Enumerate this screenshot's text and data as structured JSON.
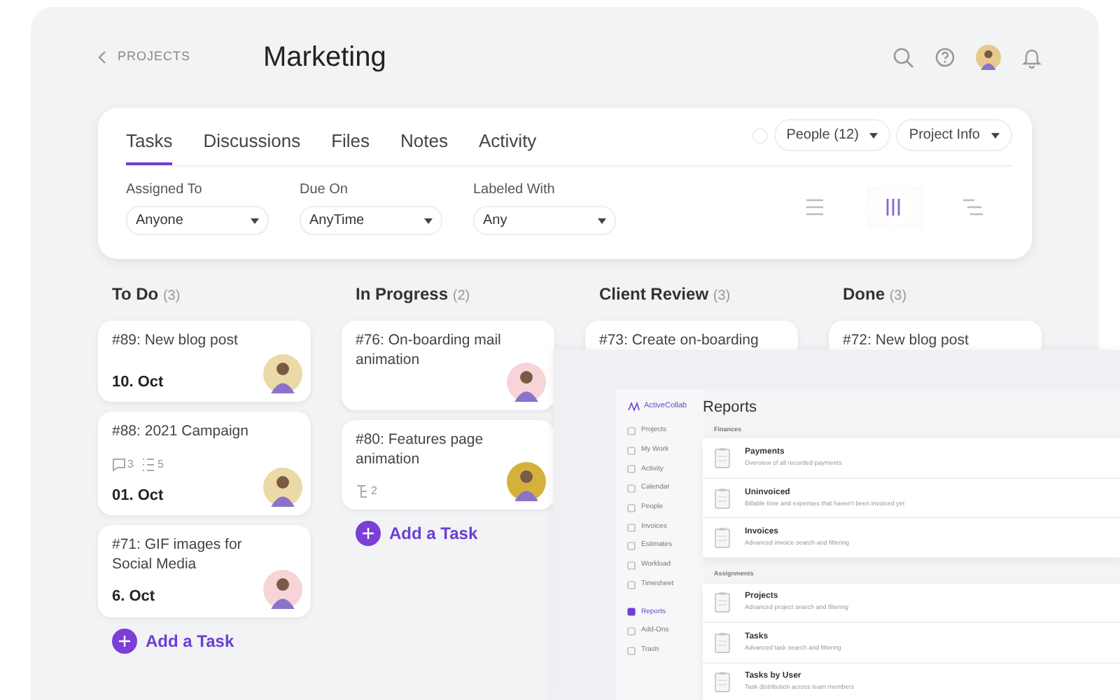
{
  "header": {
    "back_link": "PROJECTS",
    "title": "Marketing"
  },
  "tabs": [
    {
      "label": "Tasks",
      "selected": true
    },
    {
      "label": "Discussions",
      "selected": false
    },
    {
      "label": "Files",
      "selected": false
    },
    {
      "label": "Notes",
      "selected": false
    },
    {
      "label": "Activity",
      "selected": false
    }
  ],
  "people_button": "People (12)",
  "project_info_button": "Project Info",
  "filters": [
    {
      "label": "Assigned To",
      "value": "Anyone"
    },
    {
      "label": "Due On",
      "value": "AnyTime"
    },
    {
      "label": "Labeled With",
      "value": "Any"
    }
  ],
  "views": [
    {
      "kind": "list",
      "selected": false
    },
    {
      "kind": "columns",
      "selected": true
    },
    {
      "kind": "timeline",
      "selected": false
    }
  ],
  "columns": [
    {
      "title": "To Do",
      "count": "(3)",
      "add_label": "Add a Task",
      "tasks": [
        {
          "title": "#89: New blog post",
          "due": "10. Oct",
          "color": "#ecd9a8"
        },
        {
          "title": "#88: 2021 Campaign",
          "meta": [
            {
              "kind": "comments",
              "count": "3"
            },
            {
              "kind": "checklist",
              "count": "5"
            }
          ],
          "due": "01. Oct",
          "color": "#ecd9a8"
        },
        {
          "title": "#71: GIF images for Social Media",
          "due": "6. Oct",
          "color": "#f6d4d8"
        }
      ]
    },
    {
      "title": "In Progress",
      "count": "(2)",
      "add_label": "Add a Task",
      "tasks": [
        {
          "title": "#76: On-boarding mail animation",
          "color": "#f6d4d8"
        },
        {
          "title": "#80: Features page animation",
          "meta": [
            {
              "kind": "subtasks",
              "count": "2"
            }
          ],
          "color": "#d4b13a"
        }
      ]
    },
    {
      "title": "Client Review",
      "count": "(3)",
      "tasks": [
        {
          "title": "#73: Create on-boarding"
        }
      ]
    },
    {
      "title": "Done",
      "count": "(3)",
      "tasks": [
        {
          "title": "#72: New blog post"
        }
      ]
    }
  ],
  "reports_window": {
    "brand": "ActiveCollab",
    "title": "Reports",
    "nav": [
      {
        "label": "Projects",
        "selected": false
      },
      {
        "label": "My Work",
        "selected": false
      },
      {
        "label": "Activity",
        "selected": false
      },
      {
        "label": "Calendar",
        "selected": false
      },
      {
        "label": "People",
        "selected": false
      },
      {
        "label": "Invoices",
        "selected": false
      },
      {
        "label": "Estimates",
        "selected": false
      },
      {
        "label": "Workload",
        "selected": false
      },
      {
        "label": "Timesheet",
        "selected": false
      },
      {
        "label": "Reports",
        "selected": true
      },
      {
        "label": "Add-Ons",
        "selected": false
      },
      {
        "label": "Trash",
        "selected": false
      }
    ],
    "sections": [
      {
        "heading": "Finances",
        "items": [
          {
            "title": "Payments",
            "description": "Overview of all recorded payments"
          },
          {
            "title": "Uninvoiced",
            "description": "Billable time and expenses that haven't been invoiced yet"
          },
          {
            "title": "Invoices",
            "description": "Advanced invoice search and filtering"
          }
        ]
      },
      {
        "heading": "Assignments",
        "items": [
          {
            "title": "Projects",
            "description": "Advanced project search and filtering"
          },
          {
            "title": "Tasks",
            "description": "Advanced task search and filtering"
          },
          {
            "title": "Tasks by User",
            "description": "Task distribution across team members"
          }
        ]
      }
    ]
  }
}
